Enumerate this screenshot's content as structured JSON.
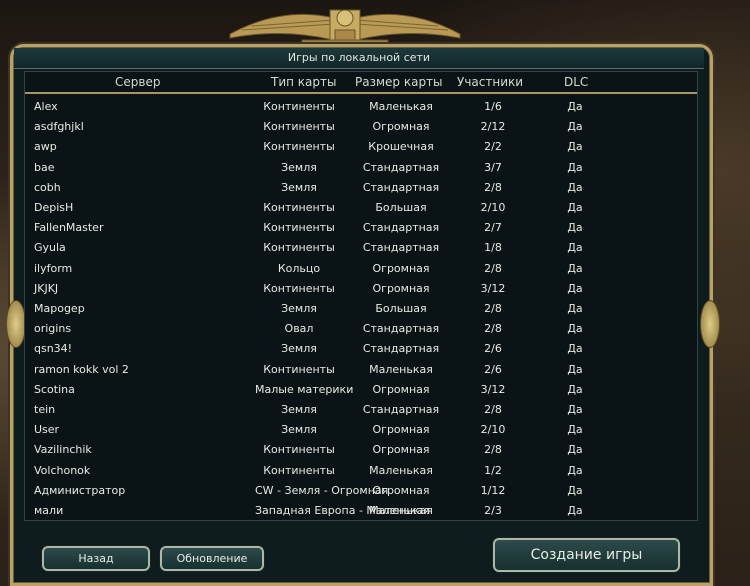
{
  "window": {
    "title": "Игры по локальной сети"
  },
  "columns": {
    "server": "Сервер",
    "map_type": "Тип карты",
    "map_size": "Размер карты",
    "players": "Участники",
    "dlc": "DLC"
  },
  "rows": [
    {
      "server": "Alex",
      "map_type": "Континенты",
      "map_size": "Маленькая",
      "players": "1/6",
      "dlc": "Да"
    },
    {
      "server": "asdfghjkl",
      "map_type": "Континенты",
      "map_size": "Огромная",
      "players": "2/12",
      "dlc": "Да"
    },
    {
      "server": "awp",
      "map_type": "Континенты",
      "map_size": "Крошечная",
      "players": "2/2",
      "dlc": "Да"
    },
    {
      "server": "bae",
      "map_type": "Земля",
      "map_size": "Стандартная",
      "players": "3/7",
      "dlc": "Да"
    },
    {
      "server": "cobh",
      "map_type": "Земля",
      "map_size": "Стандартная",
      "players": "2/8",
      "dlc": "Да"
    },
    {
      "server": "DepisH",
      "map_type": "Континенты",
      "map_size": "Большая",
      "players": "2/10",
      "dlc": "Да"
    },
    {
      "server": "FallenMaster",
      "map_type": "Континенты",
      "map_size": "Стандартная",
      "players": "2/7",
      "dlc": "Да"
    },
    {
      "server": "Gyula",
      "map_type": "Континенты",
      "map_size": "Стандартная",
      "players": "1/8",
      "dlc": "Да"
    },
    {
      "server": "ilyform",
      "map_type": "Кольцо",
      "map_size": "Огромная",
      "players": "2/8",
      "dlc": "Да"
    },
    {
      "server": "JKJKJ",
      "map_type": "Континенты",
      "map_size": "Огромная",
      "players": "3/12",
      "dlc": "Да"
    },
    {
      "server": "Mapogep",
      "map_type": "Земля",
      "map_size": "Большая",
      "players": "2/8",
      "dlc": "Да"
    },
    {
      "server": "origins",
      "map_type": "Овал",
      "map_size": "Стандартная",
      "players": "2/8",
      "dlc": "Да"
    },
    {
      "server": "qsn34!",
      "map_type": "Земля",
      "map_size": "Стандартная",
      "players": "2/6",
      "dlc": "Да"
    },
    {
      "server": "ramon kokk vol 2",
      "map_type": "Континенты",
      "map_size": "Маленькая",
      "players": "2/6",
      "dlc": "Да"
    },
    {
      "server": "Scotina",
      "map_type": "Малые материки",
      "map_size": "Огромная",
      "players": "3/12",
      "dlc": "Да"
    },
    {
      "server": "tein",
      "map_type": "Земля",
      "map_size": "Стандартная",
      "players": "2/8",
      "dlc": "Да"
    },
    {
      "server": "User",
      "map_type": "Земля",
      "map_size": "Огромная",
      "players": "2/10",
      "dlc": "Да"
    },
    {
      "server": "Vazilinchik",
      "map_type": "Континенты",
      "map_size": "Огромная",
      "players": "2/8",
      "dlc": "Да"
    },
    {
      "server": "Volchonok",
      "map_type": "Континенты",
      "map_size": "Маленькая",
      "players": "1/2",
      "dlc": "Да"
    },
    {
      "server": "Администратор",
      "map_type": "CW - Земля - Огромная",
      "map_size": "Огромная",
      "players": "1/12",
      "dlc": "Да"
    },
    {
      "server": "мали",
      "map_type": "Западная Европа - Маленькая",
      "map_size": "Маленькая",
      "players": "2/3",
      "dlc": "Да"
    }
  ],
  "buttons": {
    "back": "Назад",
    "refresh": "Обновление",
    "create": "Создание игры"
  },
  "colors": {
    "accent_gold": "#b8a26a",
    "panel": "#0e1c1e",
    "text": "#e8eae4"
  }
}
